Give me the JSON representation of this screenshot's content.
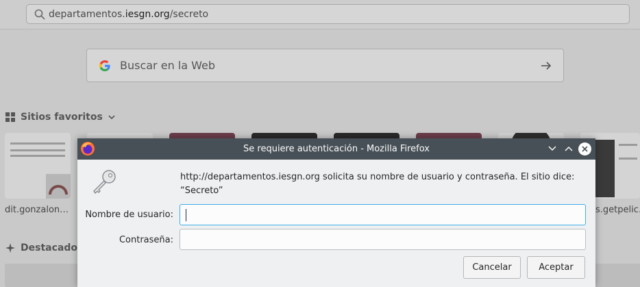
{
  "browser": {
    "url_prefix": "departamentos.",
    "url_domain": "iesgn.org",
    "url_path": "/secreto",
    "search_placeholder": "Buscar en la Web",
    "favorites_title": "Sitios favoritos",
    "highlights_title": "Destacados",
    "tiles": [
      {
        "label": "dit.gonzalon…"
      },
      {
        "label": "s.getpelic…"
      }
    ]
  },
  "dialog": {
    "title": "Se requiere autenticación - Mozilla Firefox",
    "message_line1": "http://departamentos.iesgn.org solicita su nombre de usuario y contraseña. El sitio dice:",
    "message_line2": "“Secreto”",
    "username_label": "Nombre de usuario:",
    "username_value": "",
    "password_label": "Contraseña:",
    "password_value": "",
    "cancel_label": "Cancelar",
    "accept_label": "Aceptar"
  },
  "colors": {
    "titlebar": "#475057",
    "focus": "#3daee9",
    "dialog_bg": "#eff0f1"
  }
}
